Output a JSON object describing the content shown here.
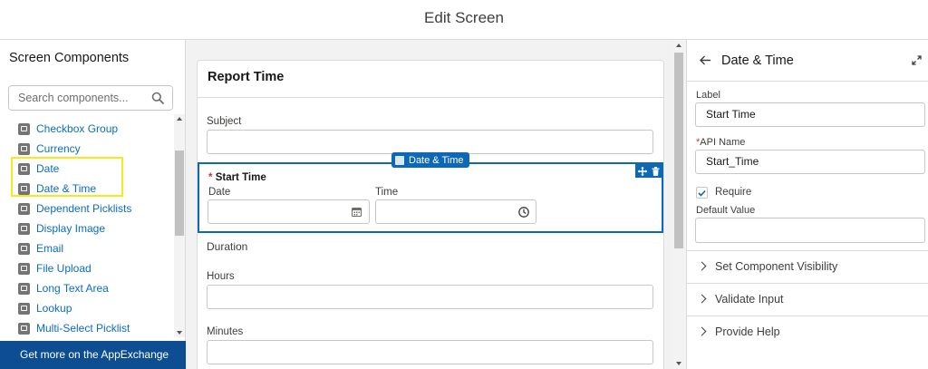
{
  "window": {
    "title": "Edit Screen"
  },
  "components_panel": {
    "title": "Screen Components",
    "search_placeholder": "Search components...",
    "items": [
      {
        "label": "Checkbox Group",
        "icon": "checkbox-group-icon"
      },
      {
        "label": "Currency",
        "icon": "currency-icon"
      },
      {
        "label": "Date",
        "icon": "date-icon"
      },
      {
        "label": "Date & Time",
        "icon": "datetime-icon"
      },
      {
        "label": "Dependent Picklists",
        "icon": "dependent-picklist-icon"
      },
      {
        "label": "Display Image",
        "icon": "image-icon"
      },
      {
        "label": "Email",
        "icon": "email-icon"
      },
      {
        "label": "File Upload",
        "icon": "file-upload-icon"
      },
      {
        "label": "Long Text Area",
        "icon": "long-text-icon"
      },
      {
        "label": "Lookup",
        "icon": "lookup-icon"
      },
      {
        "label": "Multi-Select Picklist",
        "icon": "multi-picklist-icon"
      }
    ],
    "appexchange_label": "Get more on the AppExchange"
  },
  "canvas": {
    "screen_title": "Report Time",
    "subject_label": "Subject",
    "selected_component_tag": "Date & Time",
    "start_time_label": "Start Time",
    "date_label": "Date",
    "time_label": "Time",
    "duration_label": "Duration",
    "hours_label": "Hours",
    "minutes_label": "Minutes"
  },
  "properties": {
    "title": "Date & Time",
    "label_label": "Label",
    "label_value": "Start Time",
    "api_name_label": "API Name",
    "api_name_value": "Start_Time",
    "require_label": "Require",
    "default_value_label": "Default Value",
    "sections": [
      "Set Component Visibility",
      "Validate Input",
      "Provide Help"
    ]
  },
  "colors": {
    "accent": "#0d68b5",
    "link": "#0b6cc4",
    "appexchange_bg": "#0d4d91",
    "highlight": "#f7e91e",
    "required": "#c23934"
  }
}
